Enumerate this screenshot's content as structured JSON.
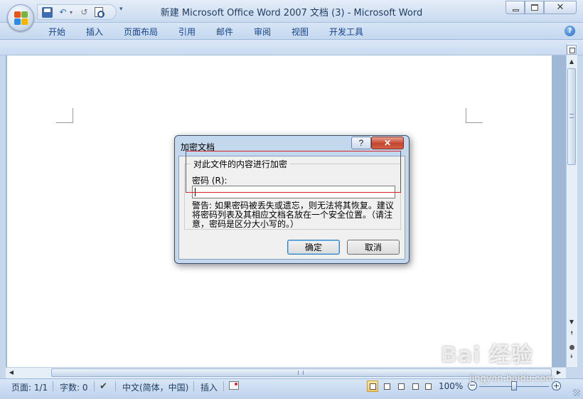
{
  "window": {
    "title": "新建 Microsoft Office Word 2007 文档 (3) - Microsoft Word",
    "close_glyph": "✕"
  },
  "quick_access": {
    "undo_glyph": "↶",
    "undo_dropdown_glyph": "▾",
    "redo_glyph": "↺",
    "customize_glyph": "▾"
  },
  "ribbon": {
    "tabs": [
      "开始",
      "插入",
      "页面布局",
      "引用",
      "邮件",
      "审阅",
      "视图",
      "开发工具"
    ],
    "help_glyph": "?"
  },
  "scrollbars": {
    "up": "▲",
    "down": "▼",
    "prev_page": "⯭",
    "next_page": "⯯",
    "left": "◀",
    "right": "▶"
  },
  "status_bar": {
    "page": "页面: 1/1",
    "words": "字数: 0",
    "proofing_glyph": "✔",
    "language": "中文(简体，中国)",
    "insert_mode": "插入",
    "zoom": "100%",
    "zoom_out": "−",
    "zoom_in": "+",
    "zoom_fraction": 0.5
  },
  "dialog": {
    "title": "加密文档",
    "help_glyph": "?",
    "close_glyph": "✕",
    "group_label": "对此文件的内容进行加密",
    "password_label": "密码 (R):",
    "password_value": "",
    "warning": "警告: 如果密码被丢失或遗忘，则无法将其恢复。建议将密码列表及其相应文档名放在一个安全位置。（请注意，密码是区分大小写的。）",
    "ok_label": "确定",
    "cancel_label": "取消"
  },
  "watermark": {
    "logo": "Bai 经验",
    "url": "jingyan.baidu.com"
  },
  "colors": {
    "highlight_box": "#d3232b",
    "ribbon_text": "#15428b",
    "dialog_frame": "#b9d1ea"
  }
}
